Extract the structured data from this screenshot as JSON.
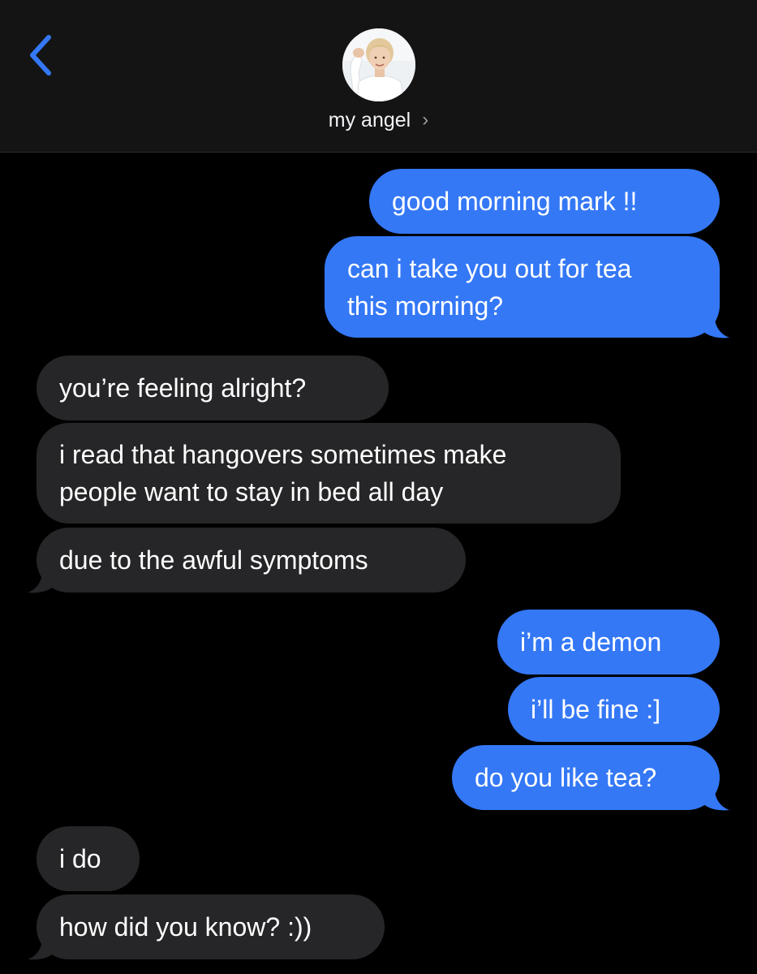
{
  "header": {
    "contact_name": "my angel",
    "chevron": "›",
    "back_icon": "chevron-left-icon",
    "avatar_icon": "contact-avatar"
  },
  "colors": {
    "outgoing": "#3478f6",
    "incoming": "#262628",
    "accent": "#3478f6",
    "header_bg": "#141414"
  },
  "messages": [
    {
      "direction": "outgoing",
      "text": "good morning mark !!"
    },
    {
      "direction": "outgoing",
      "lines": [
        "can i take you out for tea",
        "this morning?"
      ]
    },
    {
      "direction": "incoming",
      "text": "you’re feeling alright?"
    },
    {
      "direction": "incoming",
      "lines": [
        "i read that hangovers sometimes make",
        "people want to stay in bed all day"
      ]
    },
    {
      "direction": "incoming",
      "text": "due to the awful symptoms"
    },
    {
      "direction": "outgoing",
      "text": "i’m a demon"
    },
    {
      "direction": "outgoing",
      "text": "i’ll be fine :]"
    },
    {
      "direction": "outgoing",
      "text": "do you like tea?"
    },
    {
      "direction": "incoming",
      "text": "i do"
    },
    {
      "direction": "incoming",
      "text": "how did you know? :))"
    }
  ]
}
